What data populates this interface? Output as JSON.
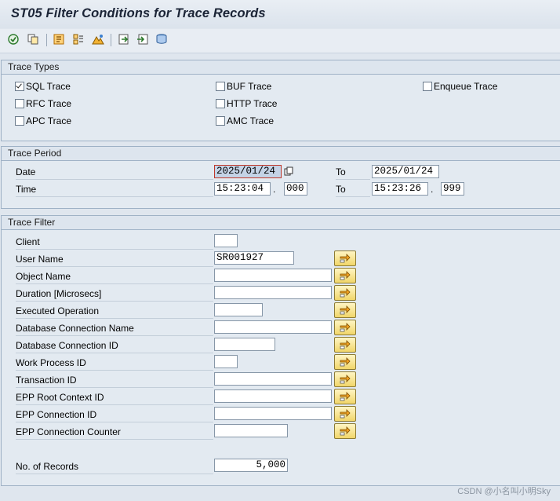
{
  "window": {
    "title": "ST05 Filter Conditions for Trace Records"
  },
  "toolbar": {
    "icons": [
      "execute-icon",
      "copy-icon",
      "activate-icon",
      "display-icon",
      "analyze-icon",
      "export-icon",
      "import-icon",
      "database-icon"
    ]
  },
  "trace_types": {
    "header": "Trace Types",
    "items": [
      {
        "label": "SQL Trace",
        "checked": true
      },
      {
        "label": "BUF Trace",
        "checked": false
      },
      {
        "label": "Enqueue Trace",
        "checked": false
      },
      {
        "label": "RFC Trace",
        "checked": false
      },
      {
        "label": "HTTP Trace",
        "checked": false
      },
      {
        "label": "APC Trace",
        "checked": false
      },
      {
        "label": "AMC Trace",
        "checked": false
      }
    ]
  },
  "trace_period": {
    "header": "Trace Period",
    "date_label": "Date",
    "time_label": "Time",
    "to_label": "To",
    "date_from": "2025/01/24",
    "date_to": "2025/01/24",
    "time_from": "15:23:04",
    "time_from_ms": "000",
    "time_to": "15:23:26",
    "time_to_ms": "999",
    "ms_separator": "."
  },
  "trace_filter": {
    "header": "Trace Filter",
    "rows": [
      {
        "label": "Client",
        "value": ""
      },
      {
        "label": "User Name",
        "value": "SR001927"
      },
      {
        "label": "Object Name",
        "value": ""
      },
      {
        "label": "Duration [Microsecs]",
        "value": ""
      },
      {
        "label": "Executed Operation",
        "value": ""
      },
      {
        "label": "Database Connection Name",
        "value": ""
      },
      {
        "label": "Database Connection ID",
        "value": ""
      },
      {
        "label": "Work Process ID",
        "value": ""
      },
      {
        "label": "Transaction ID",
        "value": ""
      },
      {
        "label": "EPP Root Context ID",
        "value": ""
      },
      {
        "label": "EPP Connection ID",
        "value": ""
      },
      {
        "label": "EPP Connection Counter",
        "value": ""
      }
    ],
    "records_label": "No. of Records",
    "records_value": "5,000"
  },
  "watermark": "CSDN @小名叫小明Sky"
}
